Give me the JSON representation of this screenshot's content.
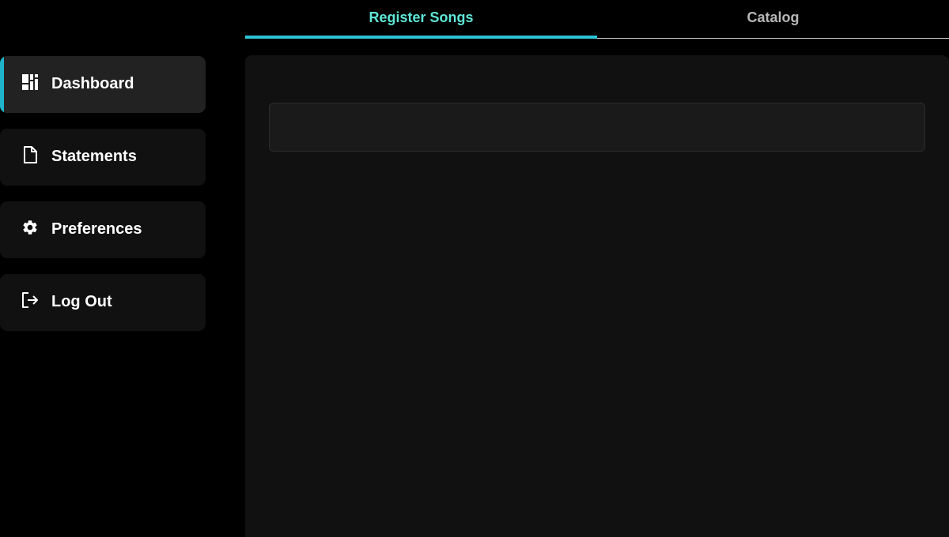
{
  "tabs": [
    {
      "label": "Register Songs",
      "active": true
    },
    {
      "label": "Catalog",
      "active": false
    }
  ],
  "sidebar": {
    "items": [
      {
        "label": "Dashboard",
        "icon": "dashboard-icon",
        "active": true
      },
      {
        "label": "Statements",
        "icon": "document-icon",
        "active": false
      },
      {
        "label": "Preferences",
        "icon": "gear-icon",
        "active": false
      },
      {
        "label": "Log Out",
        "icon": "logout-icon",
        "active": false
      }
    ]
  },
  "colors": {
    "accent": "#2fc3d6",
    "active_tab_text": "#5ee6d6",
    "background": "#000000",
    "panel": "#111111"
  }
}
